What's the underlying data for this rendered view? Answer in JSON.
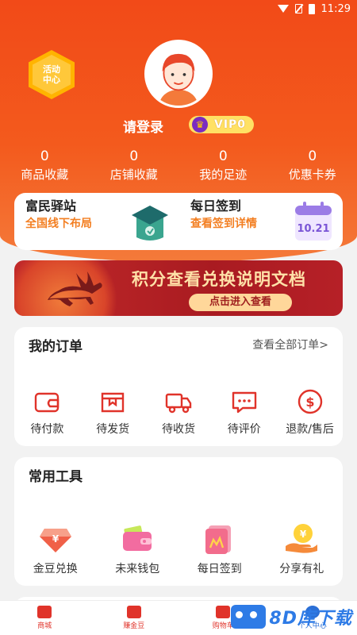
{
  "status_bar": {
    "time": "11:29",
    "icons": [
      "wifi-icon",
      "no-sim-icon",
      "battery-icon"
    ]
  },
  "header": {
    "activity_badge": {
      "line1": "活动",
      "line2": "中心"
    },
    "login_text": "请登录",
    "vip_label": "VIP0",
    "stats": [
      {
        "value": "0",
        "label": "商品收藏"
      },
      {
        "value": "0",
        "label": "店铺收藏"
      },
      {
        "value": "0",
        "label": "我的足迹"
      },
      {
        "value": "0",
        "label": "优惠卡券"
      }
    ]
  },
  "promo": {
    "station": {
      "title": "富民驿站",
      "subtitle": "全国线下布局"
    },
    "signin": {
      "title": "每日签到",
      "subtitle": "查看签到详情",
      "calendar_date": "10.21"
    }
  },
  "banner": {
    "title": "积分查看兑换说明文档",
    "button": "点击进入查看"
  },
  "orders": {
    "title": "我的订单",
    "more": "查看全部订单>",
    "items": [
      {
        "label": "待付款",
        "icon": "wallet-icon"
      },
      {
        "label": "待发货",
        "icon": "package-icon"
      },
      {
        "label": "待收货",
        "icon": "truck-icon"
      },
      {
        "label": "待评价",
        "icon": "comment-icon"
      },
      {
        "label": "退款/售后",
        "icon": "refund-icon"
      }
    ]
  },
  "tools": {
    "title": "常用工具",
    "items": [
      {
        "label": "金豆兑换",
        "icon": "bean-exchange-icon"
      },
      {
        "label": "未来钱包",
        "icon": "wallet-icon"
      },
      {
        "label": "每日签到",
        "icon": "signin-icon"
      },
      {
        "label": "分享有礼",
        "icon": "share-gift-icon"
      }
    ]
  },
  "tabbar": {
    "items": [
      {
        "label": "商城"
      },
      {
        "label": "赚金豆"
      },
      {
        "label": "购物车"
      },
      {
        "label": "个人中心"
      }
    ]
  },
  "watermark": "8D库下载",
  "colors": {
    "primary": "#f24a18",
    "accent_orange": "#f37f22",
    "icon_red": "#e0332a",
    "vip_yellow": "#ffe164"
  }
}
